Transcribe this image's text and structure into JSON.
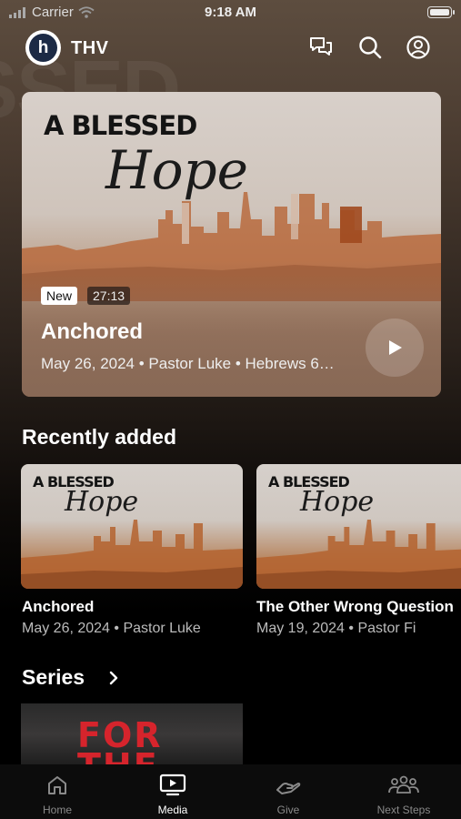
{
  "status_bar": {
    "carrier": "Carrier",
    "time": "9:18 AM"
  },
  "header": {
    "logo_letter": "h",
    "brand": "THV",
    "icons": [
      "chat-icon",
      "search-icon",
      "profile-icon"
    ]
  },
  "background_ghost_text": "SSED",
  "hero": {
    "art_title": "A BLESSED",
    "art_script": "Hope",
    "badge_new": "New",
    "duration": "27:13",
    "title": "Anchored",
    "meta": "May 26, 2024 • Pastor Luke • Hebrews 6…"
  },
  "recently_added": {
    "heading": "Recently added",
    "items": [
      {
        "art_title": "A BLESSED",
        "art_script": "Hope",
        "title": "Anchored",
        "meta": "May 26, 2024 • Pastor Luke"
      },
      {
        "art_title": "A BLESSED",
        "art_script": "Hope",
        "title": "The Other Wrong Question",
        "meta": "May 19, 2024 • Pastor Fi"
      }
    ]
  },
  "series": {
    "heading": "Series",
    "card_text": "FOR THE"
  },
  "tabs": [
    {
      "label": "Home",
      "icon": "home-icon",
      "active": false
    },
    {
      "label": "Media",
      "icon": "tv-play-icon",
      "active": true
    },
    {
      "label": "Give",
      "icon": "give-hand-icon",
      "active": false
    },
    {
      "label": "Next Steps",
      "icon": "people-icon",
      "active": false
    }
  ],
  "colors": {
    "accent_orange": "#c0632c",
    "background": "#000000",
    "tab_inactive": "#8a8a8a"
  }
}
